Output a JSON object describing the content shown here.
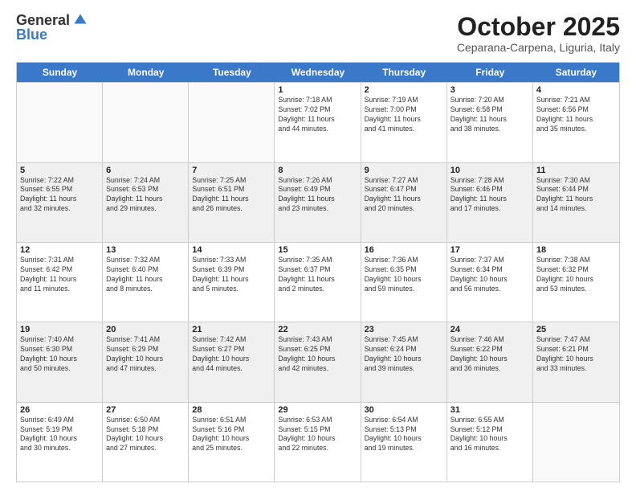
{
  "header": {
    "logo_general": "General",
    "logo_blue": "Blue",
    "month_title": "October 2025",
    "location": "Ceparana-Carpena, Liguria, Italy"
  },
  "weekdays": [
    "Sunday",
    "Monday",
    "Tuesday",
    "Wednesday",
    "Thursday",
    "Friday",
    "Saturday"
  ],
  "weeks": [
    [
      {
        "day": "",
        "info": ""
      },
      {
        "day": "",
        "info": ""
      },
      {
        "day": "",
        "info": ""
      },
      {
        "day": "1",
        "info": "Sunrise: 7:18 AM\nSunset: 7:02 PM\nDaylight: 11 hours\nand 44 minutes."
      },
      {
        "day": "2",
        "info": "Sunrise: 7:19 AM\nSunset: 7:00 PM\nDaylight: 11 hours\nand 41 minutes."
      },
      {
        "day": "3",
        "info": "Sunrise: 7:20 AM\nSunset: 6:58 PM\nDaylight: 11 hours\nand 38 minutes."
      },
      {
        "day": "4",
        "info": "Sunrise: 7:21 AM\nSunset: 6:56 PM\nDaylight: 11 hours\nand 35 minutes."
      }
    ],
    [
      {
        "day": "5",
        "info": "Sunrise: 7:22 AM\nSunset: 6:55 PM\nDaylight: 11 hours\nand 32 minutes."
      },
      {
        "day": "6",
        "info": "Sunrise: 7:24 AM\nSunset: 6:53 PM\nDaylight: 11 hours\nand 29 minutes."
      },
      {
        "day": "7",
        "info": "Sunrise: 7:25 AM\nSunset: 6:51 PM\nDaylight: 11 hours\nand 26 minutes."
      },
      {
        "day": "8",
        "info": "Sunrise: 7:26 AM\nSunset: 6:49 PM\nDaylight: 11 hours\nand 23 minutes."
      },
      {
        "day": "9",
        "info": "Sunrise: 7:27 AM\nSunset: 6:47 PM\nDaylight: 11 hours\nand 20 minutes."
      },
      {
        "day": "10",
        "info": "Sunrise: 7:28 AM\nSunset: 6:46 PM\nDaylight: 11 hours\nand 17 minutes."
      },
      {
        "day": "11",
        "info": "Sunrise: 7:30 AM\nSunset: 6:44 PM\nDaylight: 11 hours\nand 14 minutes."
      }
    ],
    [
      {
        "day": "12",
        "info": "Sunrise: 7:31 AM\nSunset: 6:42 PM\nDaylight: 11 hours\nand 11 minutes."
      },
      {
        "day": "13",
        "info": "Sunrise: 7:32 AM\nSunset: 6:40 PM\nDaylight: 11 hours\nand 8 minutes."
      },
      {
        "day": "14",
        "info": "Sunrise: 7:33 AM\nSunset: 6:39 PM\nDaylight: 11 hours\nand 5 minutes."
      },
      {
        "day": "15",
        "info": "Sunrise: 7:35 AM\nSunset: 6:37 PM\nDaylight: 11 hours\nand 2 minutes."
      },
      {
        "day": "16",
        "info": "Sunrise: 7:36 AM\nSunset: 6:35 PM\nDaylight: 10 hours\nand 59 minutes."
      },
      {
        "day": "17",
        "info": "Sunrise: 7:37 AM\nSunset: 6:34 PM\nDaylight: 10 hours\nand 56 minutes."
      },
      {
        "day": "18",
        "info": "Sunrise: 7:38 AM\nSunset: 6:32 PM\nDaylight: 10 hours\nand 53 minutes."
      }
    ],
    [
      {
        "day": "19",
        "info": "Sunrise: 7:40 AM\nSunset: 6:30 PM\nDaylight: 10 hours\nand 50 minutes."
      },
      {
        "day": "20",
        "info": "Sunrise: 7:41 AM\nSunset: 6:29 PM\nDaylight: 10 hours\nand 47 minutes."
      },
      {
        "day": "21",
        "info": "Sunrise: 7:42 AM\nSunset: 6:27 PM\nDaylight: 10 hours\nand 44 minutes."
      },
      {
        "day": "22",
        "info": "Sunrise: 7:43 AM\nSunset: 6:25 PM\nDaylight: 10 hours\nand 42 minutes."
      },
      {
        "day": "23",
        "info": "Sunrise: 7:45 AM\nSunset: 6:24 PM\nDaylight: 10 hours\nand 39 minutes."
      },
      {
        "day": "24",
        "info": "Sunrise: 7:46 AM\nSunset: 6:22 PM\nDaylight: 10 hours\nand 36 minutes."
      },
      {
        "day": "25",
        "info": "Sunrise: 7:47 AM\nSunset: 6:21 PM\nDaylight: 10 hours\nand 33 minutes."
      }
    ],
    [
      {
        "day": "26",
        "info": "Sunrise: 6:49 AM\nSunset: 5:19 PM\nDaylight: 10 hours\nand 30 minutes."
      },
      {
        "day": "27",
        "info": "Sunrise: 6:50 AM\nSunset: 5:18 PM\nDaylight: 10 hours\nand 27 minutes."
      },
      {
        "day": "28",
        "info": "Sunrise: 6:51 AM\nSunset: 5:16 PM\nDaylight: 10 hours\nand 25 minutes."
      },
      {
        "day": "29",
        "info": "Sunrise: 6:53 AM\nSunset: 5:15 PM\nDaylight: 10 hours\nand 22 minutes."
      },
      {
        "day": "30",
        "info": "Sunrise: 6:54 AM\nSunset: 5:13 PM\nDaylight: 10 hours\nand 19 minutes."
      },
      {
        "day": "31",
        "info": "Sunrise: 6:55 AM\nSunset: 5:12 PM\nDaylight: 10 hours\nand 16 minutes."
      },
      {
        "day": "",
        "info": ""
      }
    ]
  ]
}
